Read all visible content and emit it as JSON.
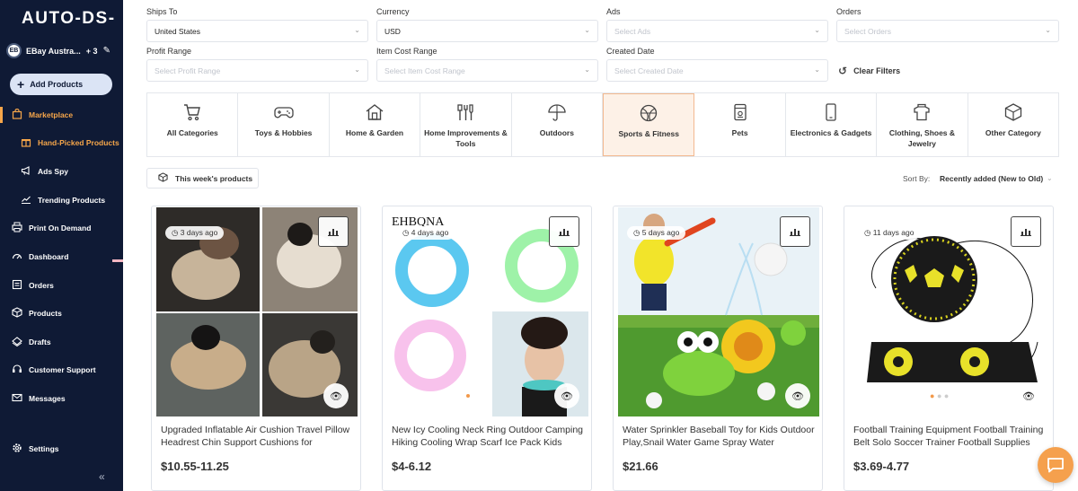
{
  "sidebar": {
    "logo": "AUTO-DS-",
    "store": {
      "avatar": "EB",
      "name": "EBay Austra...",
      "extra": "+ 3"
    },
    "add_button": "Add Products",
    "items": [
      {
        "label": "Marketplace",
        "icon": "shop-bag-icon"
      },
      {
        "label": "Hand-Picked Products",
        "icon": "gift-icon"
      },
      {
        "label": "Ads Spy",
        "icon": "megaphone-icon"
      },
      {
        "label": "Trending Products",
        "icon": "trending-icon"
      },
      {
        "label": "Print On Demand",
        "icon": "printer-icon"
      },
      {
        "label": "Dashboard",
        "icon": "gauge-icon"
      },
      {
        "label": "Orders",
        "icon": "orders-icon"
      },
      {
        "label": "Products",
        "icon": "box-icon"
      },
      {
        "label": "Drafts",
        "icon": "drafts-icon"
      },
      {
        "label": "Customer Support",
        "icon": "support-icon"
      },
      {
        "label": "Messages",
        "icon": "envelope-icon"
      },
      {
        "label": "Settings",
        "icon": "gear-icon"
      }
    ],
    "collapse": "«"
  },
  "filters": {
    "ships_to": {
      "label": "Ships To",
      "value": "United States"
    },
    "currency": {
      "label": "Currency",
      "value": "USD"
    },
    "ads": {
      "label": "Ads",
      "placeholder": "Select Ads"
    },
    "orders": {
      "label": "Orders",
      "placeholder": "Select Orders"
    },
    "profit_range": {
      "label": "Profit Range",
      "placeholder": "Select Profit Range"
    },
    "item_cost_range": {
      "label": "Item Cost Range",
      "placeholder": "Select Item Cost Range"
    },
    "created_date": {
      "label": "Created Date",
      "placeholder": "Select Created Date"
    },
    "clear": "Clear Filters"
  },
  "categories": [
    {
      "label": "All Categories",
      "icon": "cart-icon"
    },
    {
      "label": "Toys & Hobbies",
      "icon": "gamepad-icon"
    },
    {
      "label": "Home & Garden",
      "icon": "house-icon"
    },
    {
      "label": "Home Improvements & Tools",
      "icon": "tools-icon"
    },
    {
      "label": "Outdoors",
      "icon": "umbrella-icon"
    },
    {
      "label": "Sports & Fitness",
      "icon": "ball-icon"
    },
    {
      "label": "Pets",
      "icon": "pet-food-icon"
    },
    {
      "label": "Electronics & Gadgets",
      "icon": "phone-icon"
    },
    {
      "label": "Clothing, Shoes & Jewelry",
      "icon": "shirt-icon"
    },
    {
      "label": "Other Category",
      "icon": "cube-icon"
    }
  ],
  "week_button": "This week's products",
  "sort": {
    "label": "Sort By:",
    "value": "Recently added (New to Old)"
  },
  "products": [
    {
      "age": "3 days ago",
      "title": "Upgraded Inflatable Air Cushion Travel Pillow Headrest Chin Support Cushions for Airplane...",
      "price": "$10.55-11.25"
    },
    {
      "age": "4 days ago",
      "title": "New Icy Cooling Neck Ring Outdoor Camping Hiking Cooling Wrap Scarf Ice Pack Kids Adul...",
      "price": "$4-6.12",
      "brand": "EHBQNA"
    },
    {
      "age": "5 days ago",
      "title": "Water Sprinkler Baseball Toy for Kids Outdoor Play,Snail Water Game Spray Water Baseball...",
      "price": "$21.66"
    },
    {
      "age": "11 days ago",
      "title": "Football Training Equipment Football Training Belt Solo Soccer Trainer Football Supplies",
      "price": "$3.69-4.77"
    }
  ],
  "colors": {
    "sidebar_bg": "#0f1a35",
    "accent": "#f6a64a",
    "active_category_bg": "#fdf1e7"
  }
}
